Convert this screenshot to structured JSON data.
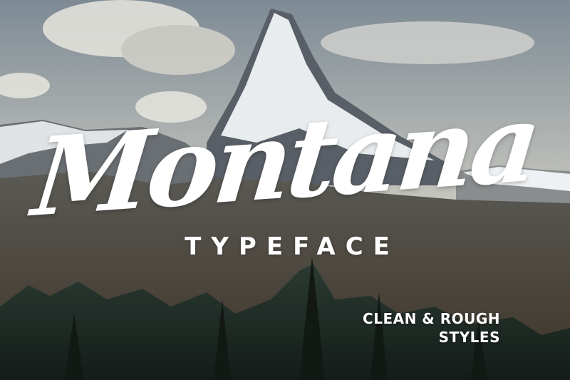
{
  "poster": {
    "title": "Montana",
    "subtitle": "TYPEFACE",
    "tagline_line1": "CLEAN & ROUGH",
    "tagline_line2": "STYLES"
  },
  "colors": {
    "sky_top": "#7f8c96",
    "sky_bottom": "#d9d6cc",
    "snow": "#eef1f3",
    "rock": "#4a4f55",
    "slope": "#6b5a45",
    "forest": "#1f2a24",
    "text": "#ffffff"
  }
}
